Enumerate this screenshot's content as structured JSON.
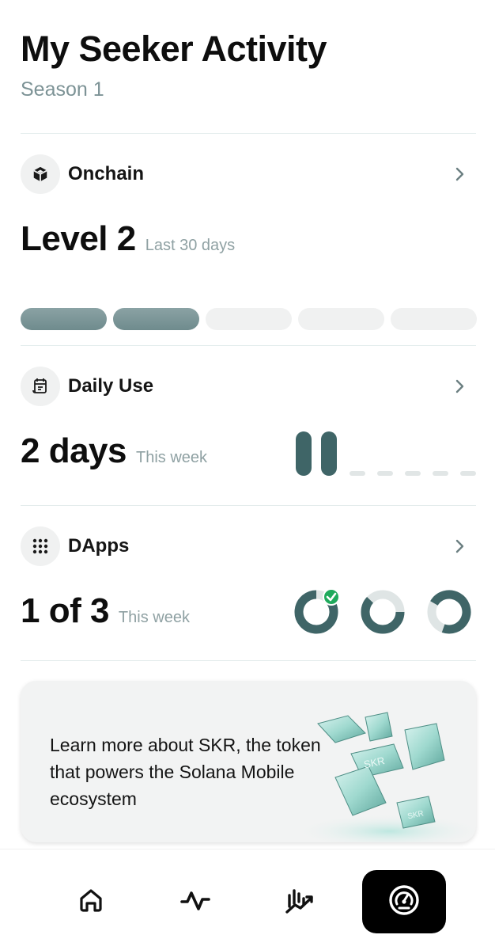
{
  "header": {
    "title": "My Seeker Activity",
    "subtitle": "Season 1"
  },
  "onchain": {
    "label": "Onchain",
    "icon": "cube-icon",
    "value": "Level 2",
    "caption": "Last 30 days",
    "levels_filled": 2,
    "levels_total": 5
  },
  "daily_use": {
    "label": "Daily Use",
    "icon": "calendar-icon",
    "value": "2 days",
    "caption": "This week",
    "days_active": 2,
    "days_total": 7
  },
  "dapps": {
    "label": "DApps",
    "icon": "grid-dots-icon",
    "value": "1 of 3",
    "caption": "This week",
    "completed": 1,
    "total": 3
  },
  "banner": {
    "text": "Learn more about SKR, the token that powers the Solana Mobile ecosystem",
    "token_label": "SKR"
  },
  "nav": {
    "items": [
      {
        "name": "home",
        "icon": "home-icon"
      },
      {
        "name": "activity",
        "icon": "activity-pulse-icon"
      },
      {
        "name": "trends",
        "icon": "chart-trend-icon"
      },
      {
        "name": "dashboard",
        "icon": "gauge-icon",
        "active": true
      }
    ]
  },
  "colors": {
    "accent_dark": "#3f6567",
    "accent_light": "#8aa2a4",
    "muted_text": "#8fa1a3",
    "check_green": "#1faa5c",
    "track": "#f0f1f1"
  }
}
